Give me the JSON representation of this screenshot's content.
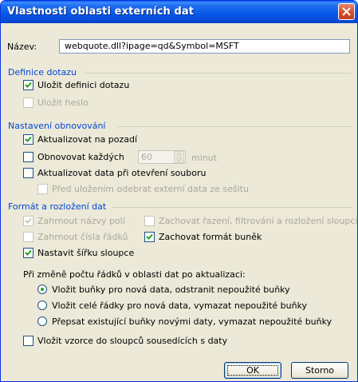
{
  "window": {
    "title": "Vlastnosti oblasti externích dat"
  },
  "name": {
    "label": "Název:",
    "value": "webquote.dll?ipage=qd&Symbol=MSFT"
  },
  "query_definition": {
    "heading": "Definice dotazu",
    "save_query": {
      "label": "Uložit definici dotazu",
      "checked": true
    },
    "save_password": {
      "label": "Uložit heslo",
      "checked": false,
      "disabled": true
    }
  },
  "refresh": {
    "heading": "Nastavení obnovování",
    "background": {
      "label": "Aktualizovat na pozadí",
      "checked": true
    },
    "every": {
      "label": "Obnovovat každých",
      "checked": false,
      "value": "60",
      "unit": "minut"
    },
    "on_open": {
      "label": "Aktualizovat data při otevření souboru",
      "checked": false
    },
    "remove_before_save": {
      "label": "Před uložením odebrat externí data ze sešitu",
      "checked": false,
      "disabled": true
    }
  },
  "format": {
    "heading": "Formát a rozložení dat",
    "field_names": {
      "label": "Zahrnout názvy polí",
      "checked": true,
      "disabled": true
    },
    "row_numbers": {
      "label": "Zahrnout čísla řádků",
      "checked": false,
      "disabled": true
    },
    "column_width": {
      "label": "Nastavit šířku sloupce",
      "checked": true
    },
    "preserve_sort": {
      "label": "Zachovat řazení, filtrování a rozložení sloupců",
      "checked": false,
      "disabled": true
    },
    "preserve_format": {
      "label": "Zachovat formát buněk",
      "checked": true
    }
  },
  "row_change": {
    "prompt": "Při změně počtu řádků v oblasti dat po aktualizaci:",
    "options": [
      {
        "label": "Vložit buňky pro nová data, odstranit nepoužité buňky",
        "selected": true
      },
      {
        "label": "Vložit celé řádky pro nová data, vymazat nepoužité buňky",
        "selected": false
      },
      {
        "label": "Přepsat existující buňky novými daty, vymazat nepoužité buňky",
        "selected": false
      }
    ]
  },
  "fill_formulas": {
    "label": "Vložit vzorce do sloupců sousedících s daty",
    "checked": false
  },
  "buttons": {
    "ok": "OK",
    "cancel": "Storno"
  },
  "icons": {
    "check": "check-icon",
    "close": "close-icon",
    "up": "arrow-up-icon",
    "down": "arrow-down-icon"
  },
  "colors": {
    "title_bar": "#0a4cd8",
    "section_heading": "#0046d5",
    "dialog_bg": "#ece9d8",
    "check_green": "#21a121",
    "close_red": "#d54a2a"
  }
}
